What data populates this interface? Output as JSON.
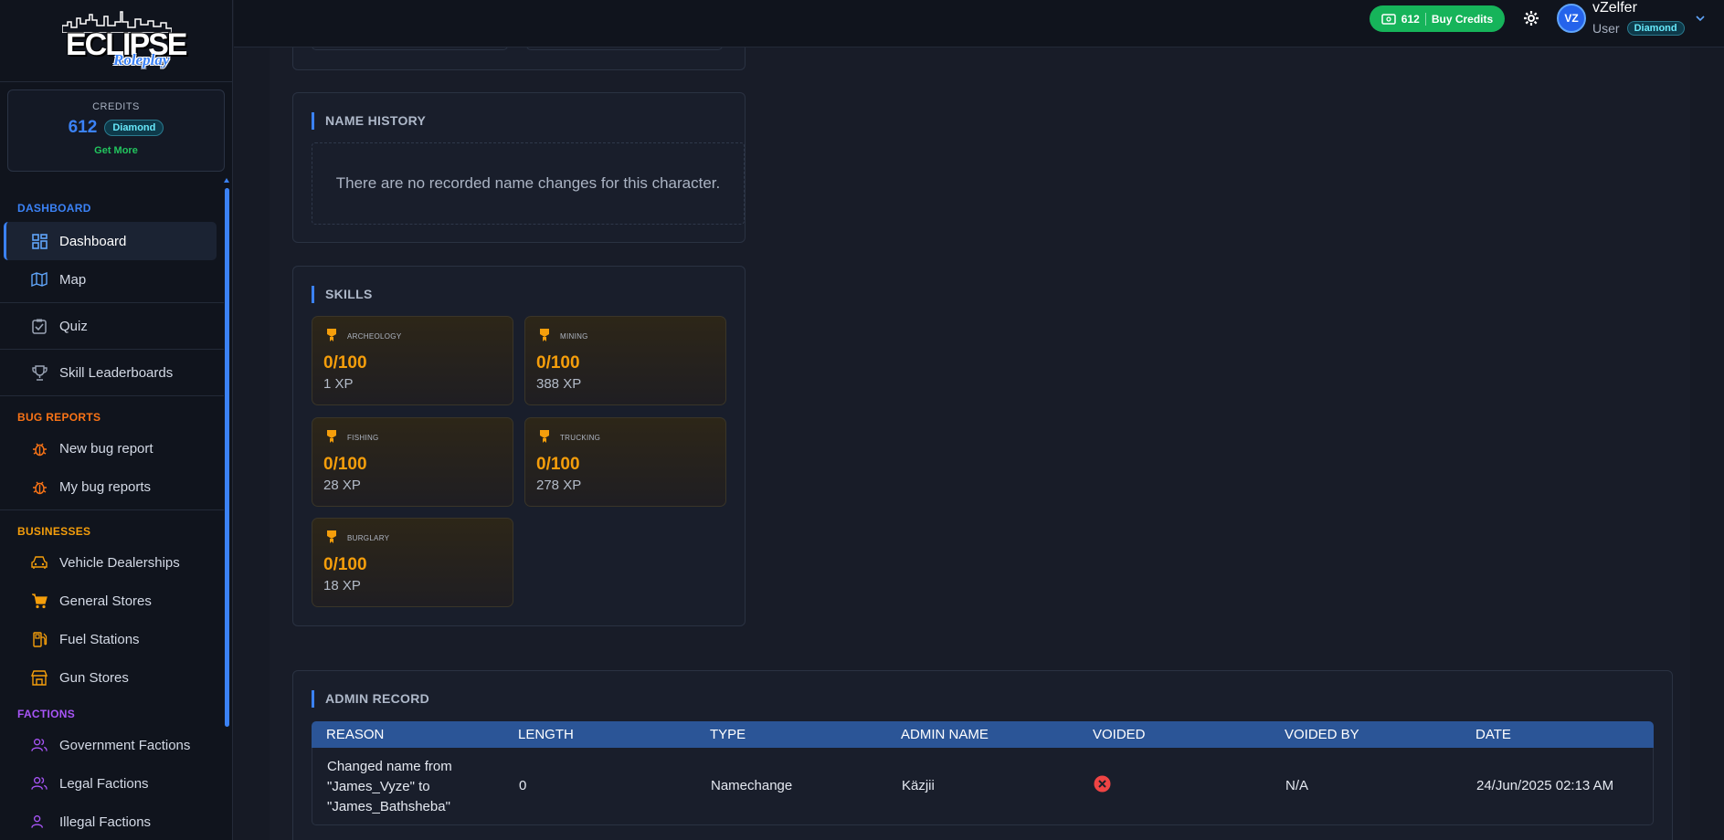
{
  "brand": {
    "logo_main": "ECLIPSE",
    "logo_sub": "Roleplay"
  },
  "credits": {
    "label": "CREDITS",
    "value": "612",
    "tier": "Diamond",
    "get_more": "Get More"
  },
  "sidebar": {
    "sections": [
      {
        "title": "DASHBOARD",
        "color": "#3b82f6",
        "items": [
          {
            "label": "Dashboard",
            "icon": "dashboard-icon",
            "active": true
          },
          {
            "label": "Map",
            "icon": "map-icon"
          }
        ]
      },
      {
        "title": "",
        "items": [
          {
            "label": "Quiz",
            "icon": "quiz-icon"
          }
        ]
      },
      {
        "title": "",
        "items": [
          {
            "label": "Skill Leaderboards",
            "icon": "trophy-icon"
          }
        ]
      },
      {
        "title": "BUG REPORTS",
        "color": "#f97316",
        "items": [
          {
            "label": "New bug report",
            "icon": "bug-icon"
          },
          {
            "label": "My bug reports",
            "icon": "bug-icon"
          }
        ]
      },
      {
        "title": "BUSINESSES",
        "color": "#f59e0b",
        "items": [
          {
            "label": "Vehicle Dealerships",
            "icon": "car-icon"
          },
          {
            "label": "General Stores",
            "icon": "cart-icon"
          },
          {
            "label": "Fuel Stations",
            "icon": "fuel-icon"
          },
          {
            "label": "Gun Stores",
            "icon": "store-icon"
          }
        ]
      },
      {
        "title": "FACTIONS",
        "color": "#a855f7",
        "items": [
          {
            "label": "Government Factions",
            "icon": "users-icon"
          },
          {
            "label": "Legal Factions",
            "icon": "users-icon"
          },
          {
            "label": "Illegal Factions",
            "icon": "users-icon"
          }
        ]
      }
    ]
  },
  "topbar": {
    "credits": "612",
    "buy_label": "Buy Credits",
    "avatar_initials": "VZ",
    "username": "vZelfer",
    "role": "User",
    "tier": "Diamond"
  },
  "name_history": {
    "title": "NAME HISTORY",
    "empty_text": "There are no recorded name changes for this character."
  },
  "skills": {
    "title": "SKILLS",
    "items": [
      {
        "name": "ARCHEOLOGY",
        "value": "0/100",
        "xp": "1 XP"
      },
      {
        "name": "MINING",
        "value": "0/100",
        "xp": "388 XP"
      },
      {
        "name": "FISHING",
        "value": "0/100",
        "xp": "28 XP"
      },
      {
        "name": "TRUCKING",
        "value": "0/100",
        "xp": "278 XP"
      },
      {
        "name": "BURGLARY",
        "value": "0/100",
        "xp": "18 XP"
      }
    ]
  },
  "admin_record": {
    "title": "ADMIN RECORD",
    "columns": [
      "REASON",
      "LENGTH",
      "TYPE",
      "ADMIN NAME",
      "VOIDED",
      "VOIDED BY",
      "DATE"
    ],
    "rows": [
      {
        "reason_lines": [
          "Changed name from",
          "\"James_Vyze\" to",
          "\"James_Bathsheba\""
        ],
        "length": "0",
        "type": "Namechange",
        "admin": "Käzjii",
        "voided_icon": "x-circle-icon",
        "voided_by": "N/A",
        "date": "24/Jun/2025 02:13 AM"
      }
    ]
  },
  "colors": {
    "accent": "#3b82f6",
    "skill_value": "#f59e0b",
    "success": "#16b45a",
    "danger": "#ef4444"
  }
}
